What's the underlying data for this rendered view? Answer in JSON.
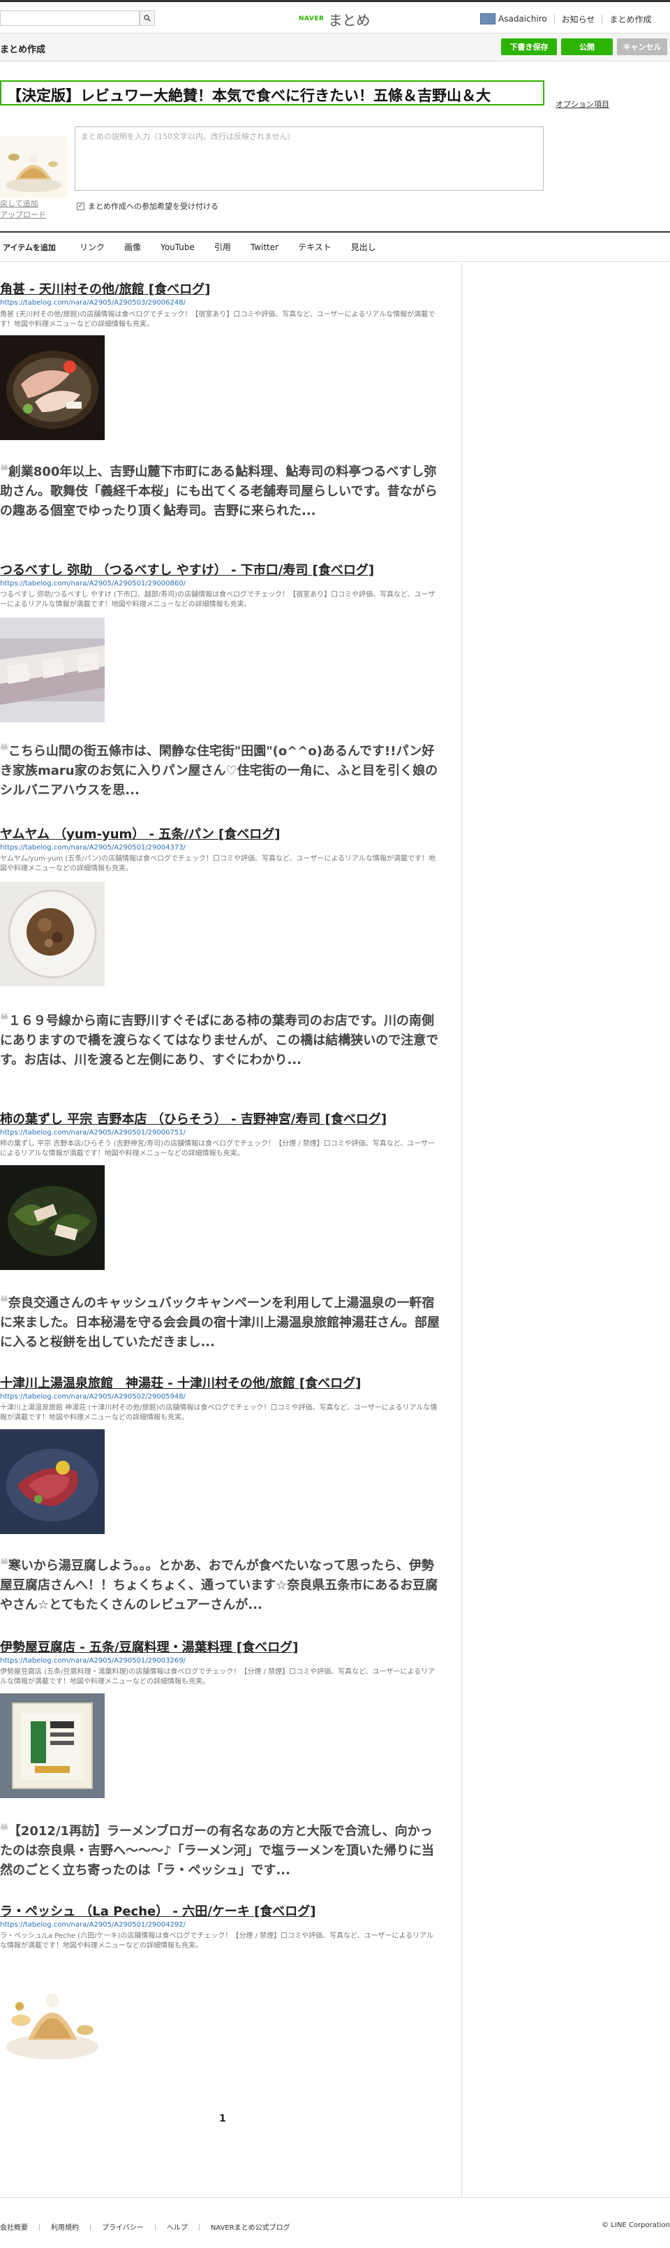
{
  "header": {
    "search_placeholder": "",
    "logo_naver": "NAVER",
    "logo_matome": "まとめ",
    "username": "Asadaichiro",
    "notifications": "お知らせ",
    "create": "まとめ作成"
  },
  "editor": {
    "page_title": "まとめ作成",
    "save_draft": "下書き保存",
    "publish": "公開",
    "cancel": "キャンセル",
    "matome_title": "【決定版】レビュワー大絶賛！本気で食べに行きたい！五條＆吉野山＆大",
    "option_link": "オプション項目",
    "description_placeholder": "まとめの説明を入力（150文字以内。改行は反映されません）",
    "thumb_change": "戻して追加",
    "thumb_upload": "アップロード",
    "participate_label": "まとめ作成への参加希望を受け付ける",
    "participate_checked": "✓"
  },
  "toolbar": {
    "label": "アイテムを追加",
    "items": [
      "リンク",
      "画像",
      "YouTube",
      "引用",
      "Twitter",
      "テキスト",
      "見出し"
    ]
  },
  "entries": [
    {
      "title": "角甚 - 天川村その他/旅館 [食べログ]",
      "url": "https://tabelog.com/nara/A2905/A290503/29006248/",
      "desc": "角甚 (天川村その他/旅館)の店舗情報は食べログでチェック！【宿室あり】口コミや評価、写真など、ユーザーによるリアルな情報が満載です！地図や料理メニューなどの詳細情報も充実。",
      "quote": "創業800年以上、吉野山麓下市町にある鮎料理、鮎寿司の料亭つるべすし弥助さん。歌舞伎「義経千本桜」にも出てくる老舗寿司屋らしいです。昔ながらの趣ある個室でゆったり頂く鮎寿司。吉野に来られた..."
    },
    {
      "title": "つるべすし 弥助 （つるべすし やすけ） - 下市口/寿司 [食べログ]",
      "url": "https://tabelog.com/nara/A2905/A290501/29000860/",
      "desc": "つるべすし 弥助/つるべすし やすけ (下市口、越部/寿司)の店舗情報は食べログでチェック！【宿室あり】口コミや評価、写真など、ユーザーによるリアルな情報が満載です！地図や料理メニューなどの詳細情報も充実。",
      "quote": "こちら山間の街五條市は、閑静な住宅街\"田園\"(o^^o)あるんです!!パン好き家族maru家のお気に入りパン屋さん♡住宅街の一角に、ふと目を引く娘のシルバニアハウスを思..."
    },
    {
      "title": "ヤムヤム （yum-yum） - 五条/パン [食べログ]",
      "url": "https://tabelog.com/nara/A2905/A290501/29004373/",
      "desc": "ヤムヤム/yum-yum (五条/パン)の店舗情報は食べログでチェック！口コミや評価、写真など、ユーザーによるリアルな情報が満載です！地図や料理メニューなどの詳細情報も充実。",
      "quote": "１６９号線から南に吉野川すぐそばにある柿の葉寿司のお店です。川の南側にありますので橋を渡らなくてはなりませんが、この橋は結構狭いので注意です。お店は、川を渡ると左側にあり、すぐにわかり..."
    },
    {
      "title": "柿の葉ずし 平宗 吉野本店 （ひらそう） - 吉野神宮/寿司 [食べログ]",
      "url": "https://tabelog.com/nara/A2905/A290501/29000751/",
      "desc": "柿の葉ずし 平宗 吉野本店/ひらそう (吉野神宮/寿司)の店舗情報は食べログでチェック！【分煙 / 禁煙】口コミや評価、写真など、ユーザーによるリアルな情報が満載です！地図や料理メニューなどの詳細情報も充実。",
      "quote": "奈良交通さんのキャッシュバックキャンペーンを利用して上湯温泉の一軒宿に来ました。日本秘湯を守る会会員の宿十津川上湯温泉旅館神湯荘さん。部屋に入ると桜餅を出していただきまし..."
    },
    {
      "title": "十津川上湯温泉旅館　神湯荘 - 十津川村その他/旅館 [食べログ]",
      "url": "https://tabelog.com/nara/A2905/A290502/29005948/",
      "desc": "十津川上湯温泉旅館 神湯荘 (十津川村その他/旅館)の店舗情報は食べログでチェック！口コミや評価、写真など、ユーザーによるリアルな情報が満載です！地図や料理メニューなどの詳細情報も充実。",
      "quote": "寒いから湯豆腐しよう。。。とかあ、おでんが食べたいなって思ったら、伊勢屋豆腐店さんへ！！ちょくちょく、通っています☆奈良県五条市にあるお豆腐やさん☆とてもたくさんのレビュアーさんが..."
    },
    {
      "title": "伊勢屋豆腐店 - 五条/豆腐料理・湯葉料理 [食べログ]",
      "url": "https://tabelog.com/nara/A2905/A290501/29003269/",
      "desc": "伊勢屋豆腐店 (五条/豆腐料理・湯葉料理)の店舗情報は食べログでチェック！【分煙 / 禁煙】口コミや評価、写真など、ユーザーによるリアルな情報が満載です！地図や料理メニューなどの詳細情報も充実。",
      "quote": "【2012/1再訪】ラーメンブロガーの有名なあの方と大阪で合流し、向かったのは奈良県・吉野へ～～～♪「ラーメン河」で塩ラーメンを頂いた帰りに当然のごとく立ち寄ったのは「ラ・ペッシュ」です..."
    },
    {
      "title": "ラ・ペッシュ （La Peche） - 六田/ケーキ [食べログ]",
      "url": "https://tabelog.com/nara/A2905/A290501/29004292/",
      "desc": "ラ・ペッシュ/La Peche (六田/ケーキ)の店舗情報は食べログでチェック！【分煙 / 禁煙】口コミや評価、写真など、ユーザーによるリアルな情報が満載です！地図や料理メニューなどの詳細情報も充実。",
      "quote": ""
    }
  ],
  "quote_mark": "❝",
  "pagination": {
    "current": "1"
  },
  "footer": {
    "links": [
      "会社概要",
      "利用規約",
      "プライバシー",
      "ヘルプ",
      "NAVERまとめ公式ブログ"
    ],
    "copyright": "© LINE Corporation"
  },
  "colors": {
    "accent": "#2db400",
    "link": "#2a6fb8"
  }
}
